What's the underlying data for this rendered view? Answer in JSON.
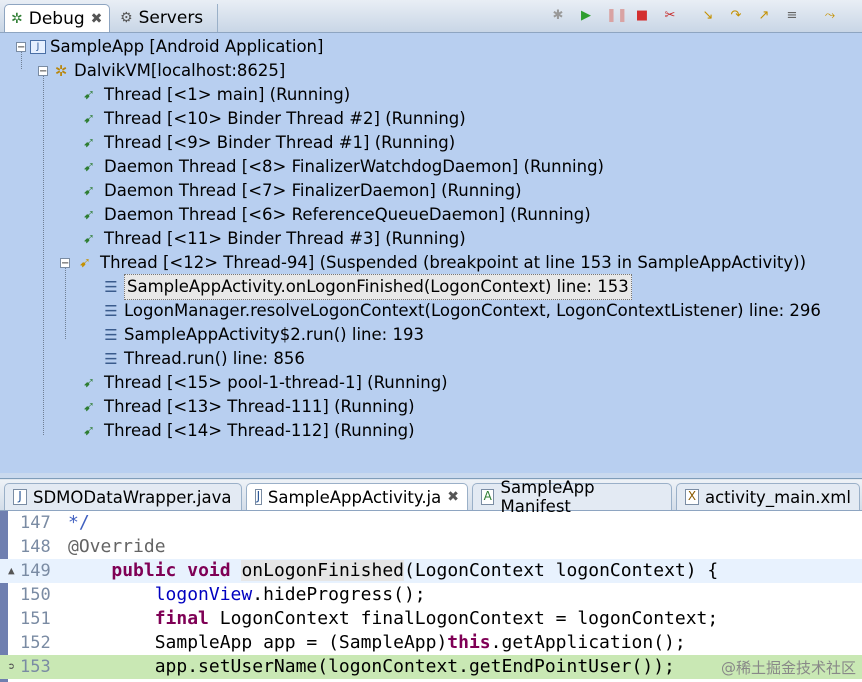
{
  "debug_tabs": [
    {
      "label": "Debug",
      "icon": "debug-bug-icon"
    },
    {
      "label": "Servers",
      "icon": "servers-icon"
    }
  ],
  "toolbar_icons": [
    "remove-launch-icon",
    "resume-icon",
    "suspend-icon",
    "terminate-icon",
    "disconnect-icon",
    "step-into-icon",
    "step-over-icon",
    "step-return-icon",
    "drop-to-frame-icon",
    "use-step-filters-icon"
  ],
  "tree": {
    "app": "SampleApp [Android Application]",
    "vm": "DalvikVM[localhost:8625]",
    "threads_before": [
      "Thread [<1> main] (Running)",
      "Thread [<10> Binder Thread #2] (Running)",
      "Thread [<9> Binder Thread #1] (Running)",
      "Daemon Thread [<8> FinalizerWatchdogDaemon] (Running)",
      "Daemon Thread [<7> FinalizerDaemon] (Running)",
      "Daemon Thread [<6> ReferenceQueueDaemon] (Running)",
      "Thread [<11> Binder Thread #3] (Running)"
    ],
    "suspended_thread": "Thread [<12> Thread-94] (Suspended (breakpoint at line 153 in SampleAppActivity))",
    "frames": [
      "SampleAppActivity.onLogonFinished(LogonContext) line: 153",
      "LogonManager.resolveLogonContext(LogonContext, LogonContextListener) line: 296",
      "SampleAppActivity$2.run() line: 193",
      "Thread.run() line: 856"
    ],
    "threads_after": [
      "Thread [<15> pool-1-thread-1] (Running)",
      "Thread [<13> Thread-111] (Running)",
      "Thread [<14> Thread-112] (Running)"
    ]
  },
  "editor_tabs": [
    {
      "label": "SDMODataWrapper.java",
      "icon": "java-file-icon"
    },
    {
      "label": "SampleAppActivity.ja",
      "icon": "java-file-icon"
    },
    {
      "label": "SampleApp Manifest",
      "icon": "manifest-icon"
    },
    {
      "label": "activity_main.xml",
      "icon": "xml-file-icon"
    }
  ],
  "code_lines": [
    {
      "no": "147",
      "parts": [
        {
          "t": "*/",
          "c": "comment"
        }
      ]
    },
    {
      "no": "148",
      "parts": [
        {
          "t": "@Override",
          "c": "anno"
        }
      ]
    },
    {
      "no": "149",
      "parts": [
        {
          "t": "    ",
          "c": ""
        },
        {
          "t": "public",
          "c": "kw"
        },
        {
          "t": " ",
          "c": ""
        },
        {
          "t": "void",
          "c": "kw"
        },
        {
          "t": " ",
          "c": ""
        },
        {
          "t": "onLogonFinished",
          "c": "method-hl"
        },
        {
          "t": "(LogonContext logonContext) {",
          "c": ""
        }
      ]
    },
    {
      "no": "150",
      "parts": [
        {
          "t": "        ",
          "c": ""
        },
        {
          "t": "logonView",
          "c": "field"
        },
        {
          "t": ".hideProgress();",
          "c": ""
        }
      ]
    },
    {
      "no": "151",
      "parts": [
        {
          "t": "        ",
          "c": ""
        },
        {
          "t": "final",
          "c": "kw"
        },
        {
          "t": " LogonContext finalLogonContext = logonContext;",
          "c": ""
        }
      ]
    },
    {
      "no": "152",
      "parts": [
        {
          "t": "        SampleApp app = (SampleApp)",
          "c": ""
        },
        {
          "t": "this",
          "c": "kw"
        },
        {
          "t": ".getApplication();",
          "c": ""
        }
      ]
    },
    {
      "no": "153",
      "parts": [
        {
          "t": "        app.setUserName(logonContext.getEndPointUser());",
          "c": ""
        }
      ]
    }
  ],
  "watermark": "@稀土掘金技术社区"
}
